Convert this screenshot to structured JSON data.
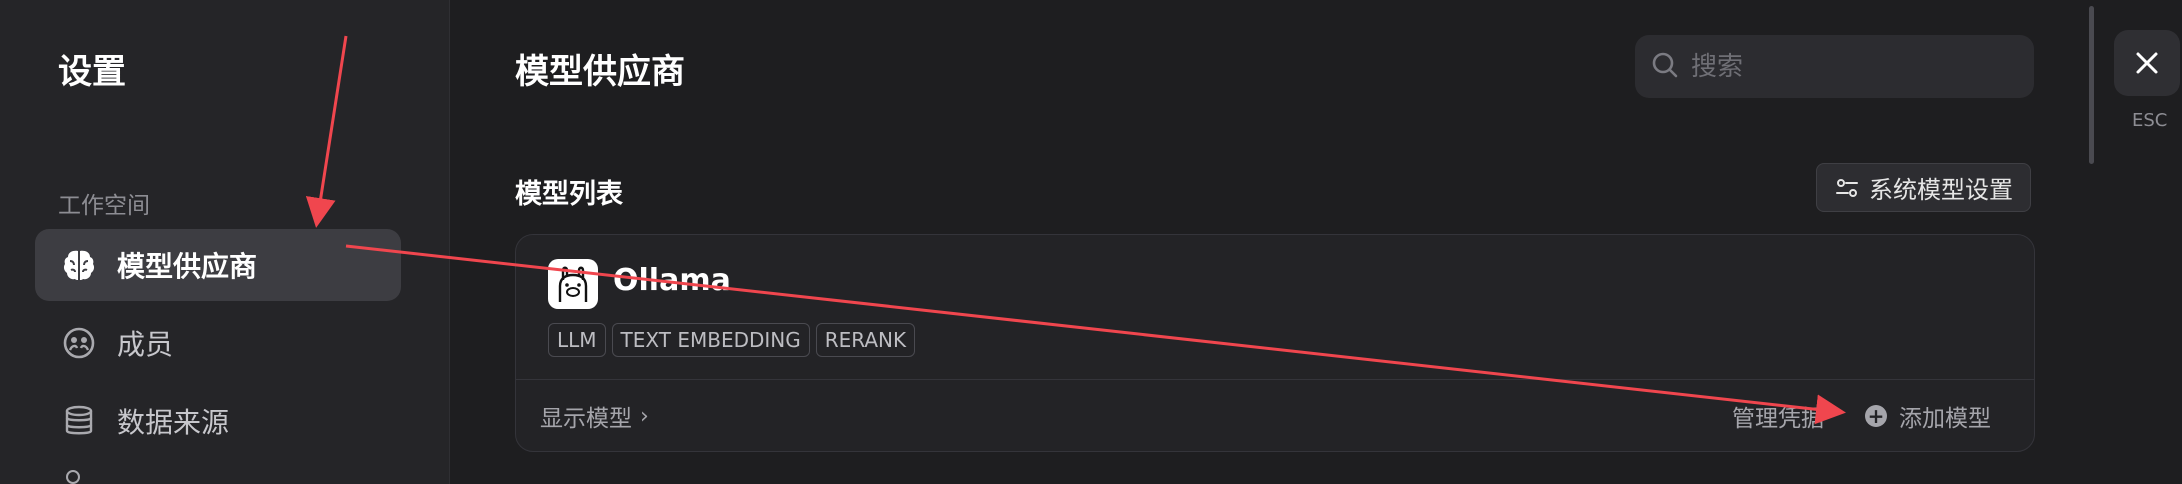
{
  "sidebar": {
    "title": "设置",
    "section_label": "工作空间",
    "items": [
      {
        "label": "模型供应商",
        "icon": "brain-icon",
        "active": true
      },
      {
        "label": "成员",
        "icon": "members-icon",
        "active": false
      },
      {
        "label": "数据来源",
        "icon": "database-icon",
        "active": false
      }
    ]
  },
  "header": {
    "title": "模型供应商",
    "search_placeholder": "搜索"
  },
  "close": {
    "esc_label": "ESC"
  },
  "model_list": {
    "title": "模型列表",
    "system_settings_label": "系统模型设置"
  },
  "provider_card": {
    "name": "Ollama",
    "tags": [
      "LLM",
      "TEXT EMBEDDING",
      "RERANK"
    ],
    "show_models_label": "显示模型",
    "manage_credentials_label": "管理凭据",
    "add_model_label": "添加模型"
  },
  "colors": {
    "background": "#1e1e20",
    "sidebar": "#252528",
    "active_item": "#3d3d42",
    "annotation_arrow": "#f0464e"
  }
}
